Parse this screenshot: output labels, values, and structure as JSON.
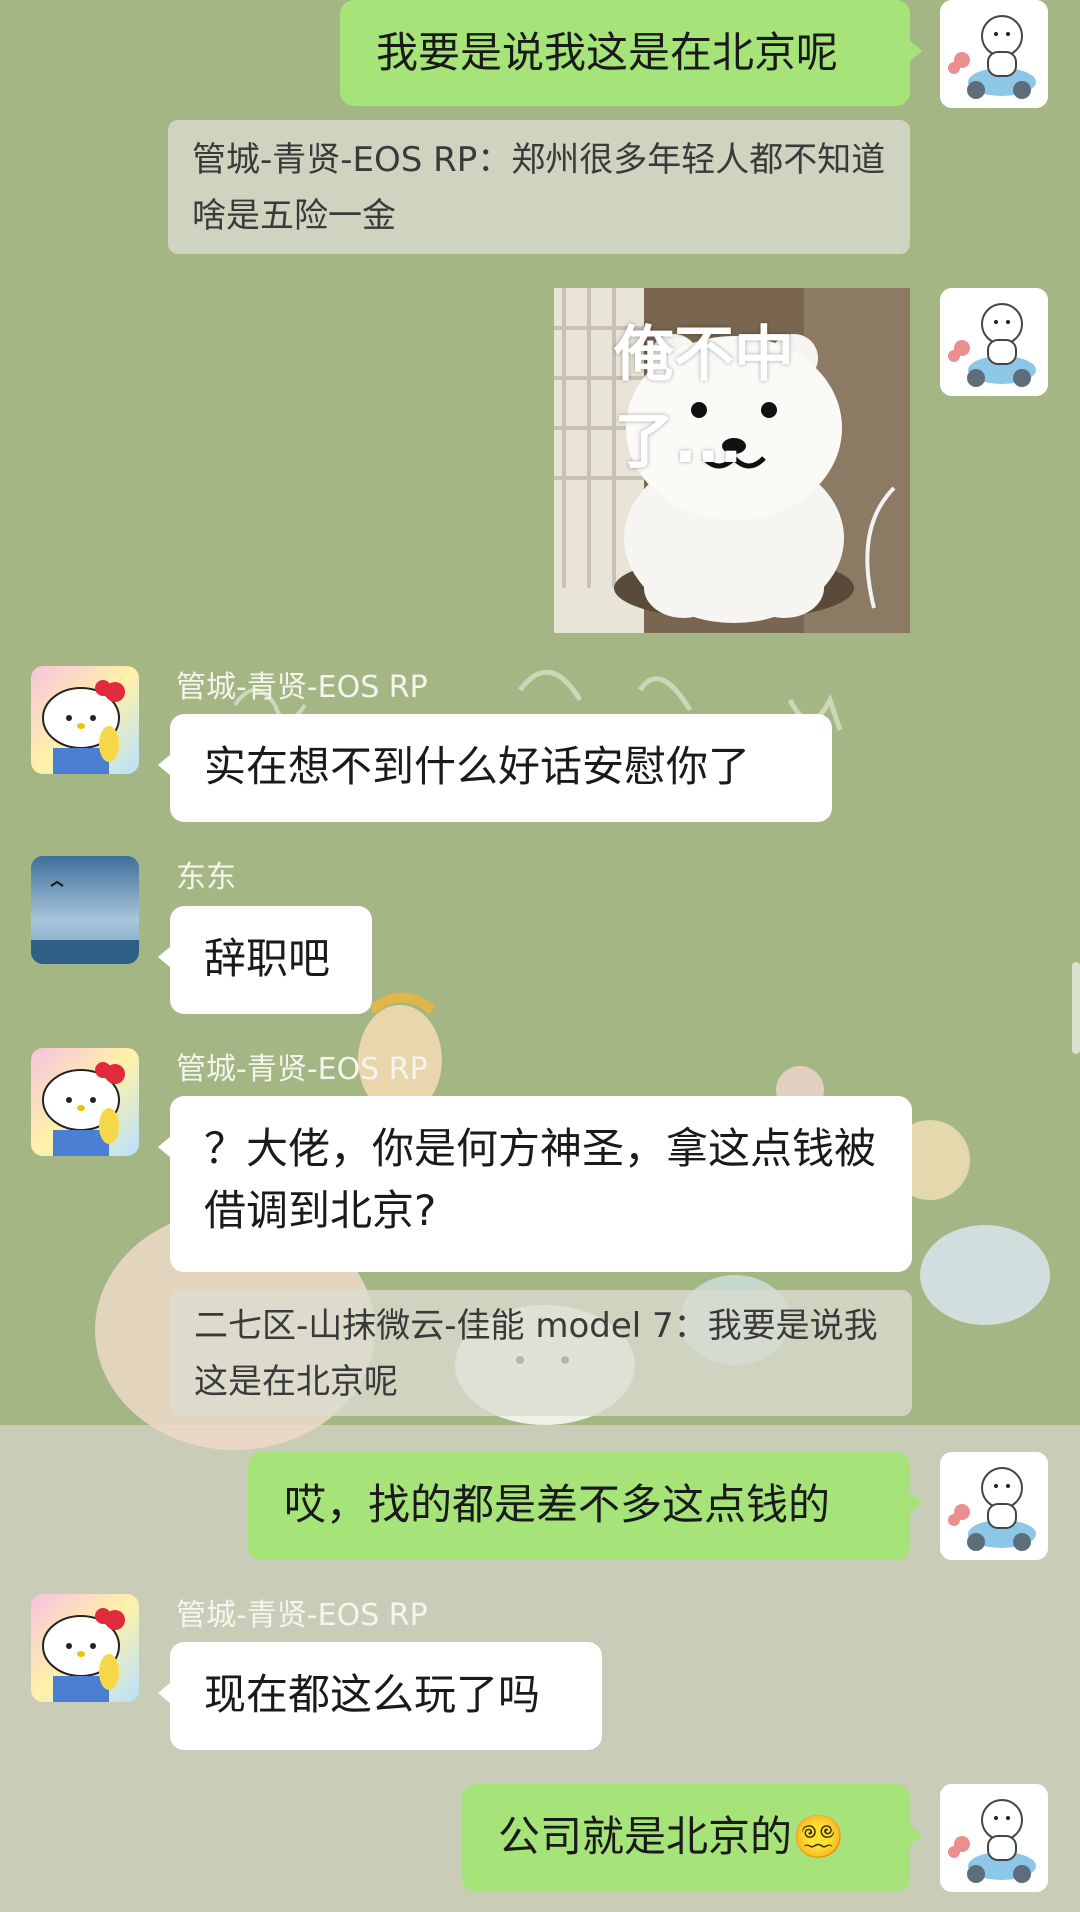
{
  "messages": {
    "m1": {
      "text": "我要是说我这是在北京呢"
    },
    "q1": {
      "text": "管城-青贤-EOS RP：郑州很多年轻人都不知道啥是五险一金"
    },
    "sticker": {
      "caption": "俺不中了..."
    },
    "m2": {
      "sender": "管城-青贤-EOS RP",
      "text": "实在想不到什么好话安慰你了"
    },
    "m3": {
      "sender": "东东",
      "text": "辞职吧"
    },
    "m4": {
      "sender": "管城-青贤-EOS RP",
      "text": "？大佬，你是何方神圣，拿这点钱被借调到北京?"
    },
    "q2": {
      "text": "二七区-山抹微云-佳能 model 7：我要是说我这是在北京呢"
    },
    "m5": {
      "text": "哎，找的都是差不多这点钱的"
    },
    "m6": {
      "sender": "管城-青贤-EOS RP",
      "text": "现在都这么玩了吗"
    },
    "m7": {
      "text": "公司就是北京的😵‍💫"
    }
  },
  "icons": {
    "self_avatar": "bear-scooter-avatar-icon",
    "kitty_avatar": "hello-kitty-avatar-icon",
    "sea_avatar": "sea-sky-avatar-icon",
    "dizzy_emoji": "dizzy-face-emoji"
  },
  "colors": {
    "chat_bg_top": "#a3b684",
    "chat_bg_bottom": "#c9cdb8",
    "outgoing_bubble": "#a6e47a",
    "incoming_bubble": "#ffffff"
  }
}
